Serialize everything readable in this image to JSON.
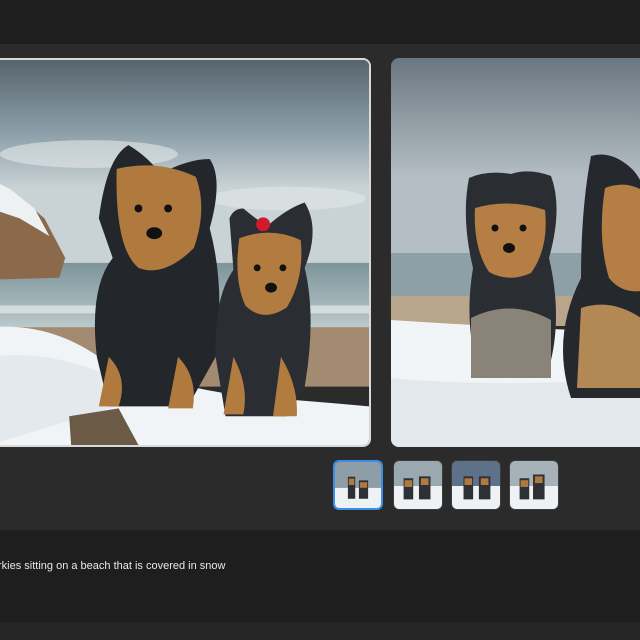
{
  "prompt": {
    "text": "rkies sitting on a beach that is covered in snow"
  },
  "previews": [
    {
      "name": "generated-image-1",
      "selected": true
    },
    {
      "name": "generated-image-2",
      "selected": false
    }
  ],
  "thumbnails": [
    {
      "name": "variation-1",
      "selected": true
    },
    {
      "name": "variation-2",
      "selected": false
    },
    {
      "name": "variation-3",
      "selected": false
    },
    {
      "name": "variation-4",
      "selected": false
    }
  ],
  "colors": {
    "selection_accent": "#3a8ee6",
    "background": "#2b2b2b",
    "prompt_panel": "#1e1e1e"
  }
}
